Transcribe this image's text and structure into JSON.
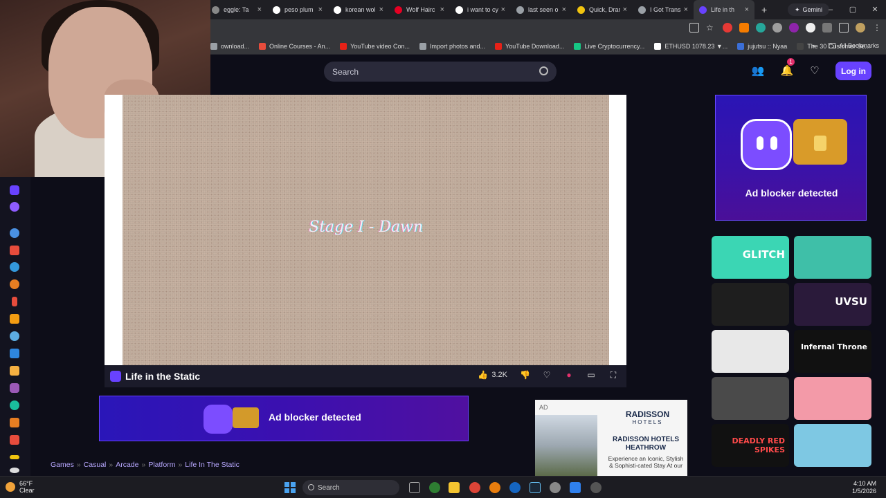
{
  "browser": {
    "tabs": [
      {
        "title": "eggle: Ta",
        "color": "#888888"
      },
      {
        "title": "peso plum",
        "color": "#ffffff"
      },
      {
        "title": "korean wol",
        "color": "#ffffff"
      },
      {
        "title": "Wolf Hairc",
        "color": "#e60023"
      },
      {
        "title": "i want to cy",
        "color": "#ffffff"
      },
      {
        "title": "last seen o",
        "color": "#9aa0a6"
      },
      {
        "title": "Quick, Dran",
        "color": "#f1c40f"
      },
      {
        "title": "I Got Trans",
        "color": "#9aa0a6"
      },
      {
        "title": "Life in th",
        "color": "#6842ff",
        "active": true
      }
    ],
    "new_tab": "+",
    "gemini_label": "Gemini",
    "window_controls": [
      "–",
      "▢",
      "✕"
    ],
    "bookmarks": [
      {
        "label": "ownload...",
        "color": "#9aa0a6"
      },
      {
        "label": "Online Courses - An...",
        "color": "#e74c3c"
      },
      {
        "label": "YouTube video Con...",
        "color": "#e62117"
      },
      {
        "label": "Import photos and...",
        "color": "#9aa0a6"
      },
      {
        "label": "YouTube Download...",
        "color": "#e62117"
      },
      {
        "label": "Live Cryptocurrency...",
        "color": "#16c784"
      },
      {
        "label": "ETHUSD 1078.23 ▼...",
        "color": "#ffffff"
      },
      {
        "label": "jujutsu :: Nyaa",
        "color": "#3b6fd8"
      },
      {
        "label": "The 30 Customer Se...",
        "color": "#444444"
      }
    ],
    "more_bookmarks": "»",
    "all_bookmarks": "All Bookmarks"
  },
  "site": {
    "search_placeholder": "Search",
    "notification_count": "1",
    "login_label": "Log in",
    "accent": "#6842ff"
  },
  "game": {
    "stage_text": "Stage I - Dawn",
    "title": "Life in the Static",
    "likes": "3.2K"
  },
  "ad_banner": {
    "text": "Ad blocker detected"
  },
  "side_ad": {
    "text": "Ad blocker detected"
  },
  "radisson_ad": {
    "ad_tag": "AD",
    "brand": "RADISSON",
    "brand_sub": "HOTELS",
    "headline": "RADISSON HOTELS HEATHROW",
    "copy": "Experience an Iconic, Stylish & Sophisti-cated Stay At our"
  },
  "breadcrumb": [
    "Games",
    "Casual",
    "Arcade",
    "Platform",
    "Life In The Static"
  ],
  "breadcrumb_sep": "»",
  "thumbnails": [
    {
      "label": "GLITCH",
      "bg": "#3bd6b4"
    },
    {
      "label": "",
      "bg": "#3fbfa8"
    },
    {
      "label": "",
      "bg": "#1e1e1e"
    },
    {
      "label": "UVSU",
      "bg": "#2a1a3a"
    },
    {
      "label": "",
      "bg": "#e8e8e8"
    },
    {
      "label": "Infernal Throne",
      "bg": "#111111"
    },
    {
      "label": "",
      "bg": "#4a4a4a"
    },
    {
      "label": "",
      "bg": "#f39aa8"
    },
    {
      "label": "DEADLY RED SPIKES",
      "bg": "#111111"
    },
    {
      "label": "",
      "bg": "#7ec8e3"
    }
  ],
  "taskbar": {
    "temperature": "66°F",
    "weather": "Clear",
    "search": "Search",
    "time": "4:10 AM",
    "date": "1/5/2026"
  }
}
